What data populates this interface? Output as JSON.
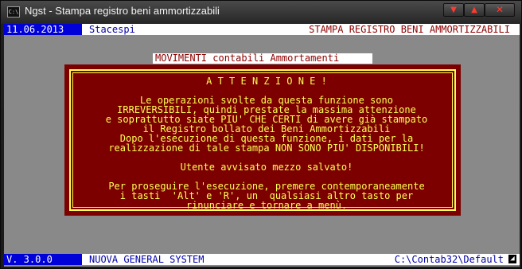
{
  "window": {
    "title": "Ngst - Stampa registro beni ammortizzabili",
    "icon_text": "C:\\",
    "buttons": {
      "minimize": "▼",
      "maximize": "▲",
      "close": "✕"
    }
  },
  "topbar": {
    "date": "11.06.2013",
    "company": "Stacespi",
    "program": "STAMPA REGISTRO BENI AMMORTIZZABILI"
  },
  "dialog": {
    "header": "MOVIMENTI contabili Ammortamenti",
    "title": "A T T E N Z I O N E !",
    "lines": [
      "Le operazioni svolte da questa funzione sono",
      "IRREVERSIBILI, quindi prestate la massima attenzione",
      "e soprattutto siate PIU' CHE CERTI di avere già stampato",
      "il Registro bollato dei Beni Ammortizzabili",
      "Dopo l'esecuzione di questa funzione, i dati per la",
      "realizzazione di tale stampa NON SONO PIU' DISPONIBILI!",
      "Utente avvisato mezzo salvato!",
      "Per proseguire l'esecuzione, premere contemporaneamente",
      "i tasti  'Alt' e 'R', un  qualsiasi altro tasto per",
      "rinunciare e tornare a menù."
    ]
  },
  "bottombar": {
    "version": "V. 3.0.0",
    "system": "NUOVA GENERAL SYSTEM",
    "path": "C:\\Contab32\\Default"
  },
  "colors": {
    "console_bg": "#898989",
    "dialog_bg": "#7c0000",
    "dialog_text": "#ffff55",
    "blue": "#0000d8"
  }
}
